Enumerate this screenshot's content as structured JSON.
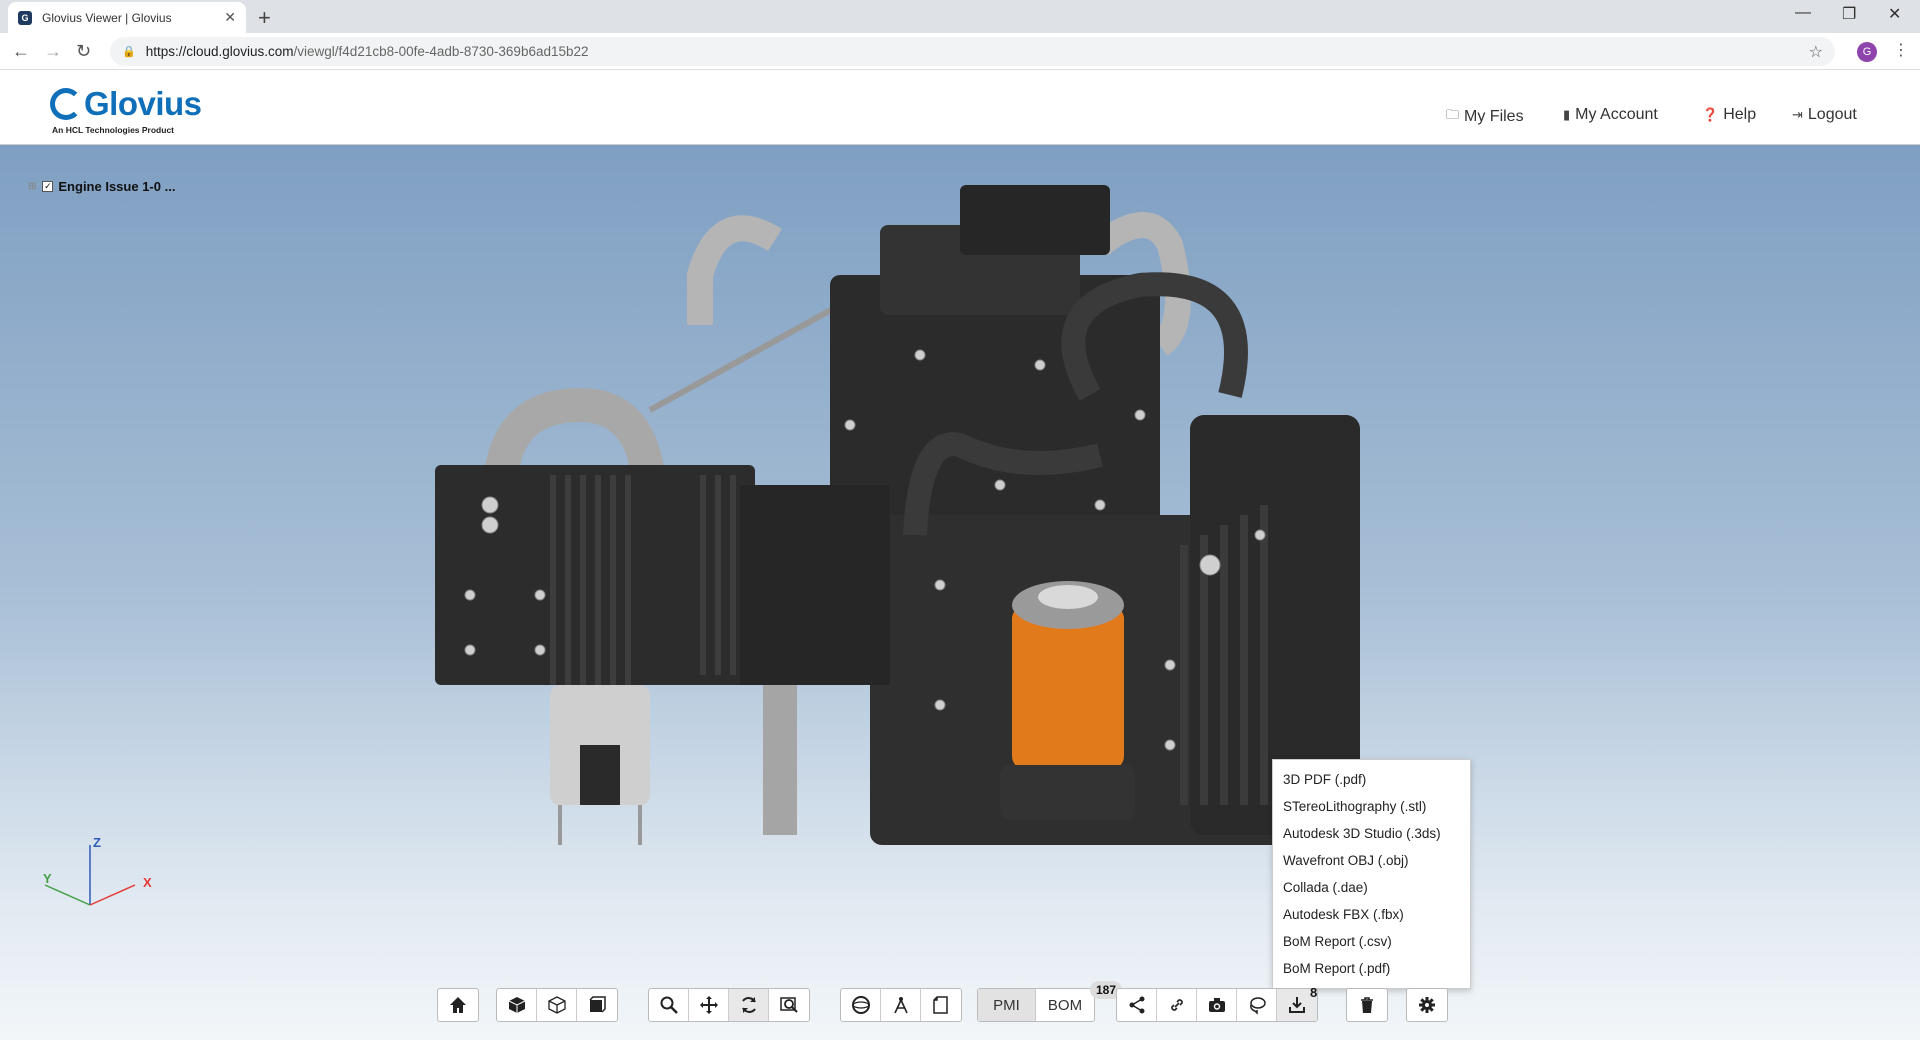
{
  "browser": {
    "tab_title": "Glovius Viewer | Glovius",
    "tab_favicon": "G",
    "url_host": "https://cloud.glovius.com",
    "url_path": "/viewgl/f4d21cb8-00fe-4adb-8730-369b6ad15b22",
    "profile_initial": "G"
  },
  "header": {
    "brand": "Glovius",
    "brand_sub": "An HCL Technologies Product",
    "nav": [
      {
        "label": "My Files",
        "icon": "files-icon"
      },
      {
        "label": "My Account",
        "icon": "account-icon"
      },
      {
        "label": "Help",
        "icon": "help-icon"
      },
      {
        "label": "Logout",
        "icon": "logout-icon"
      }
    ]
  },
  "tree": {
    "root_label": "Engine Issue 1-0 ..."
  },
  "axes": {
    "x": "X",
    "y": "Y",
    "z": "Z"
  },
  "export_menu": {
    "items": [
      "3D PDF (.pdf)",
      "STereoLithography (.stl)",
      "Autodesk 3D Studio (.3ds)",
      "Wavefront OBJ (.obj)",
      "Collada (.dae)",
      "Autodesk FBX (.fbx)",
      "BoM Report (.csv)",
      "BoM Report (.pdf)"
    ]
  },
  "toolbar": {
    "pmi_label": "PMI",
    "bom_label": "BOM",
    "bom_count": "187",
    "export_count": "8"
  },
  "colors": {
    "brand": "#0f6fb9",
    "viewport_top": "#7f9fc2",
    "viewport_bottom": "#f2f6f9",
    "accent_orange": "#e07a1a"
  }
}
